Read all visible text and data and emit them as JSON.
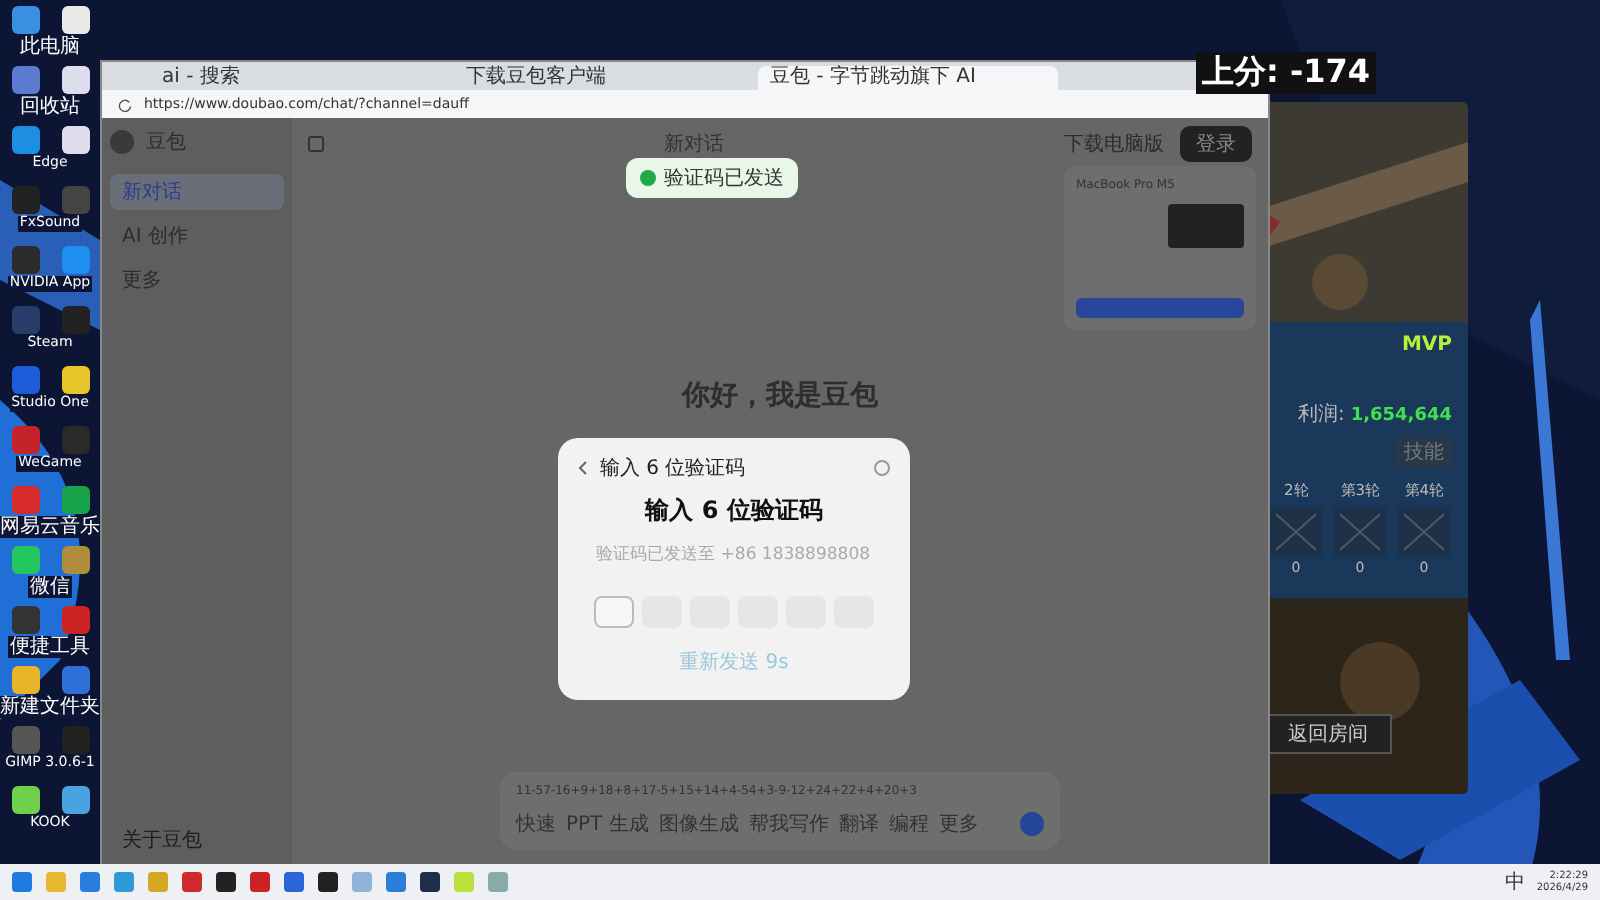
{
  "overlay_score": "上分: -174",
  "desktop_icons": [
    {
      "label": "此电脑"
    },
    {
      "label": "回收站"
    },
    {
      "label": "Edge"
    },
    {
      "label": "FxSound"
    },
    {
      "label": "NVIDIA App"
    },
    {
      "label": "Steam"
    },
    {
      "label": "Studio One"
    },
    {
      "label": "WeGame"
    },
    {
      "label": "网易云音乐"
    },
    {
      "label": "微信"
    },
    {
      "label": "便捷工具"
    },
    {
      "label": "新建文件夹"
    },
    {
      "label": "GIMP 3.0.6-1"
    },
    {
      "label": "KOOK"
    }
  ],
  "browser": {
    "tabs": [
      {
        "label": "ai - 搜索",
        "selected": false
      },
      {
        "label": "下载豆包客户端",
        "selected": false
      },
      {
        "label": "豆包 - 字节跳动旗下 AI",
        "selected": true
      }
    ],
    "url": "https://www.doubao.com/chat/?channel=dauff"
  },
  "sidebar": {
    "app_name": "豆包",
    "items": [
      {
        "label": "新对话",
        "selected": true
      },
      {
        "label": "AI 创作",
        "selected": false
      },
      {
        "label": "更多",
        "selected": false
      }
    ],
    "footer": "关于豆包"
  },
  "topbar": {
    "title": "新对话",
    "download": "下载电脑版",
    "login": "登录"
  },
  "toast": "验证码已发送",
  "promo": {
    "product": "MacBook Pro M5"
  },
  "greeting": "你好，我是豆包",
  "modal": {
    "header": "输入 6 位验证码",
    "title": "输入 6 位验证码",
    "subtitle": "验证码已发送至 +86 1838898808",
    "digits": [
      {
        "selected": true
      },
      {
        "selected": false
      },
      {
        "selected": false
      },
      {
        "selected": false
      },
      {
        "selected": false
      },
      {
        "selected": false
      }
    ],
    "resend": "重新发送 9s"
  },
  "composer": {
    "value": "11-57-16+9+18+8+17-5+15+14+4-54+3-9-12+24+22+4+20+3",
    "tools": [
      "快速",
      "PPT 生成",
      "图像生成",
      "帮我写作",
      "翻译",
      "编程",
      "更多"
    ]
  },
  "game": {
    "badge": "MVP",
    "profit_label": "利润:",
    "profit": "1,654,644",
    "skill": "技能",
    "rounds": [
      {
        "label": "2轮",
        "value": "0"
      },
      {
        "label": "第3轮",
        "value": "0"
      },
      {
        "label": "第4轮",
        "value": "0"
      }
    ],
    "back": "返回房间"
  },
  "tray": {
    "ime": "中",
    "time": "2:22:29",
    "date": "2026/4/29"
  }
}
